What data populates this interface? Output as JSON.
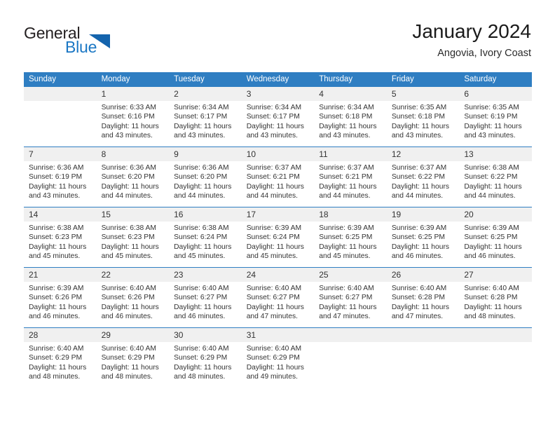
{
  "brand": {
    "name_top": "General",
    "name_bottom": "Blue",
    "triangle_icon": "triangle-icon",
    "color_dark": "#231f20",
    "color_blue": "#1b77c4"
  },
  "header": {
    "title": "January 2024",
    "subtitle": "Angovia, Ivory Coast"
  },
  "colors": {
    "header_blue": "#2f7ec2",
    "date_band_gray": "#f0f0f0",
    "text": "#333333"
  },
  "calendar": {
    "weekday_headers": [
      "Sunday",
      "Monday",
      "Tuesday",
      "Wednesday",
      "Thursday",
      "Friday",
      "Saturday"
    ],
    "weeks": [
      {
        "dates": [
          "",
          "1",
          "2",
          "3",
          "4",
          "5",
          "6"
        ],
        "cells": [
          {
            "sunrise": "",
            "sunset": "",
            "daylight_1": "",
            "daylight_2": ""
          },
          {
            "sunrise": "Sunrise: 6:33 AM",
            "sunset": "Sunset: 6:16 PM",
            "daylight_1": "Daylight: 11 hours",
            "daylight_2": "and 43 minutes."
          },
          {
            "sunrise": "Sunrise: 6:34 AM",
            "sunset": "Sunset: 6:17 PM",
            "daylight_1": "Daylight: 11 hours",
            "daylight_2": "and 43 minutes."
          },
          {
            "sunrise": "Sunrise: 6:34 AM",
            "sunset": "Sunset: 6:17 PM",
            "daylight_1": "Daylight: 11 hours",
            "daylight_2": "and 43 minutes."
          },
          {
            "sunrise": "Sunrise: 6:34 AM",
            "sunset": "Sunset: 6:18 PM",
            "daylight_1": "Daylight: 11 hours",
            "daylight_2": "and 43 minutes."
          },
          {
            "sunrise": "Sunrise: 6:35 AM",
            "sunset": "Sunset: 6:18 PM",
            "daylight_1": "Daylight: 11 hours",
            "daylight_2": "and 43 minutes."
          },
          {
            "sunrise": "Sunrise: 6:35 AM",
            "sunset": "Sunset: 6:19 PM",
            "daylight_1": "Daylight: 11 hours",
            "daylight_2": "and 43 minutes."
          }
        ]
      },
      {
        "dates": [
          "7",
          "8",
          "9",
          "10",
          "11",
          "12",
          "13"
        ],
        "cells": [
          {
            "sunrise": "Sunrise: 6:36 AM",
            "sunset": "Sunset: 6:19 PM",
            "daylight_1": "Daylight: 11 hours",
            "daylight_2": "and 43 minutes."
          },
          {
            "sunrise": "Sunrise: 6:36 AM",
            "sunset": "Sunset: 6:20 PM",
            "daylight_1": "Daylight: 11 hours",
            "daylight_2": "and 44 minutes."
          },
          {
            "sunrise": "Sunrise: 6:36 AM",
            "sunset": "Sunset: 6:20 PM",
            "daylight_1": "Daylight: 11 hours",
            "daylight_2": "and 44 minutes."
          },
          {
            "sunrise": "Sunrise: 6:37 AM",
            "sunset": "Sunset: 6:21 PM",
            "daylight_1": "Daylight: 11 hours",
            "daylight_2": "and 44 minutes."
          },
          {
            "sunrise": "Sunrise: 6:37 AM",
            "sunset": "Sunset: 6:21 PM",
            "daylight_1": "Daylight: 11 hours",
            "daylight_2": "and 44 minutes."
          },
          {
            "sunrise": "Sunrise: 6:37 AM",
            "sunset": "Sunset: 6:22 PM",
            "daylight_1": "Daylight: 11 hours",
            "daylight_2": "and 44 minutes."
          },
          {
            "sunrise": "Sunrise: 6:38 AM",
            "sunset": "Sunset: 6:22 PM",
            "daylight_1": "Daylight: 11 hours",
            "daylight_2": "and 44 minutes."
          }
        ]
      },
      {
        "dates": [
          "14",
          "15",
          "16",
          "17",
          "18",
          "19",
          "20"
        ],
        "cells": [
          {
            "sunrise": "Sunrise: 6:38 AM",
            "sunset": "Sunset: 6:23 PM",
            "daylight_1": "Daylight: 11 hours",
            "daylight_2": "and 45 minutes."
          },
          {
            "sunrise": "Sunrise: 6:38 AM",
            "sunset": "Sunset: 6:23 PM",
            "daylight_1": "Daylight: 11 hours",
            "daylight_2": "and 45 minutes."
          },
          {
            "sunrise": "Sunrise: 6:38 AM",
            "sunset": "Sunset: 6:24 PM",
            "daylight_1": "Daylight: 11 hours",
            "daylight_2": "and 45 minutes."
          },
          {
            "sunrise": "Sunrise: 6:39 AM",
            "sunset": "Sunset: 6:24 PM",
            "daylight_1": "Daylight: 11 hours",
            "daylight_2": "and 45 minutes."
          },
          {
            "sunrise": "Sunrise: 6:39 AM",
            "sunset": "Sunset: 6:25 PM",
            "daylight_1": "Daylight: 11 hours",
            "daylight_2": "and 45 minutes."
          },
          {
            "sunrise": "Sunrise: 6:39 AM",
            "sunset": "Sunset: 6:25 PM",
            "daylight_1": "Daylight: 11 hours",
            "daylight_2": "and 46 minutes."
          },
          {
            "sunrise": "Sunrise: 6:39 AM",
            "sunset": "Sunset: 6:25 PM",
            "daylight_1": "Daylight: 11 hours",
            "daylight_2": "and 46 minutes."
          }
        ]
      },
      {
        "dates": [
          "21",
          "22",
          "23",
          "24",
          "25",
          "26",
          "27"
        ],
        "cells": [
          {
            "sunrise": "Sunrise: 6:39 AM",
            "sunset": "Sunset: 6:26 PM",
            "daylight_1": "Daylight: 11 hours",
            "daylight_2": "and 46 minutes."
          },
          {
            "sunrise": "Sunrise: 6:40 AM",
            "sunset": "Sunset: 6:26 PM",
            "daylight_1": "Daylight: 11 hours",
            "daylight_2": "and 46 minutes."
          },
          {
            "sunrise": "Sunrise: 6:40 AM",
            "sunset": "Sunset: 6:27 PM",
            "daylight_1": "Daylight: 11 hours",
            "daylight_2": "and 46 minutes."
          },
          {
            "sunrise": "Sunrise: 6:40 AM",
            "sunset": "Sunset: 6:27 PM",
            "daylight_1": "Daylight: 11 hours",
            "daylight_2": "and 47 minutes."
          },
          {
            "sunrise": "Sunrise: 6:40 AM",
            "sunset": "Sunset: 6:27 PM",
            "daylight_1": "Daylight: 11 hours",
            "daylight_2": "and 47 minutes."
          },
          {
            "sunrise": "Sunrise: 6:40 AM",
            "sunset": "Sunset: 6:28 PM",
            "daylight_1": "Daylight: 11 hours",
            "daylight_2": "and 47 minutes."
          },
          {
            "sunrise": "Sunrise: 6:40 AM",
            "sunset": "Sunset: 6:28 PM",
            "daylight_1": "Daylight: 11 hours",
            "daylight_2": "and 48 minutes."
          }
        ]
      },
      {
        "dates": [
          "28",
          "29",
          "30",
          "31",
          "",
          "",
          ""
        ],
        "cells": [
          {
            "sunrise": "Sunrise: 6:40 AM",
            "sunset": "Sunset: 6:29 PM",
            "daylight_1": "Daylight: 11 hours",
            "daylight_2": "and 48 minutes."
          },
          {
            "sunrise": "Sunrise: 6:40 AM",
            "sunset": "Sunset: 6:29 PM",
            "daylight_1": "Daylight: 11 hours",
            "daylight_2": "and 48 minutes."
          },
          {
            "sunrise": "Sunrise: 6:40 AM",
            "sunset": "Sunset: 6:29 PM",
            "daylight_1": "Daylight: 11 hours",
            "daylight_2": "and 48 minutes."
          },
          {
            "sunrise": "Sunrise: 6:40 AM",
            "sunset": "Sunset: 6:29 PM",
            "daylight_1": "Daylight: 11 hours",
            "daylight_2": "and 49 minutes."
          },
          {
            "sunrise": "",
            "sunset": "",
            "daylight_1": "",
            "daylight_2": ""
          },
          {
            "sunrise": "",
            "sunset": "",
            "daylight_1": "",
            "daylight_2": ""
          },
          {
            "sunrise": "",
            "sunset": "",
            "daylight_1": "",
            "daylight_2": ""
          }
        ]
      }
    ]
  }
}
